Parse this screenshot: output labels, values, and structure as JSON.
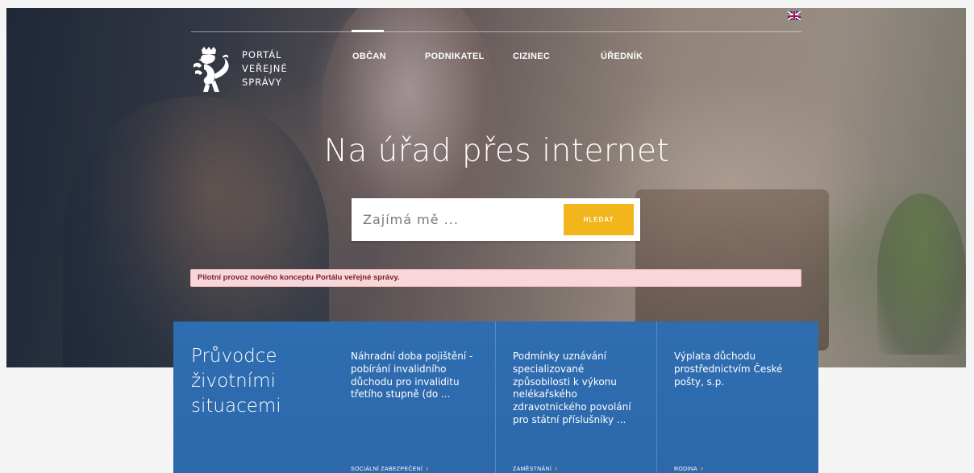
{
  "header": {
    "language_flag": "uk-flag-icon",
    "logo": {
      "line1": "PORTÁL",
      "line2": "VEŘEJNÉ",
      "line3": "SPRÁVY"
    },
    "nav": [
      {
        "label": "OBČAN",
        "active": true
      },
      {
        "label": "PODNIKATEL",
        "active": false
      },
      {
        "label": "CIZINEC",
        "active": false
      },
      {
        "label": "ÚŘEDNÍK",
        "active": false
      }
    ]
  },
  "hero": {
    "title": "Na úřad přes internet",
    "search": {
      "placeholder": "Zajímá mě ...",
      "button_label": "HLEDAT"
    }
  },
  "notice": {
    "text": "Pilotní provoz nového konceptu Portálu veřejné správy."
  },
  "guide": {
    "title": "Průvodce životními situacemi",
    "items": [
      {
        "title": "Náhradní doba pojištění - pobírání invalidního důchodu pro invaliditu třetího stupně (do ...",
        "category": "SOCIÁLNÍ ZABEZPEČENÍ"
      },
      {
        "title": "Podmínky uznávání specializované způsobilosti k výkonu nelékařského zdravotnického povolání pro státní příslušníky ...",
        "category": "ZAMĚSTNÁNÍ"
      },
      {
        "title": "Výplata důchodu prostřednictvím České pošty, s.p.",
        "category": "RODINA"
      }
    ]
  },
  "colors": {
    "accent": "#f2b51c",
    "panel_blue": "#2f6db1",
    "notice_bg": "#f8d7da",
    "notice_text": "#7a1f28"
  }
}
